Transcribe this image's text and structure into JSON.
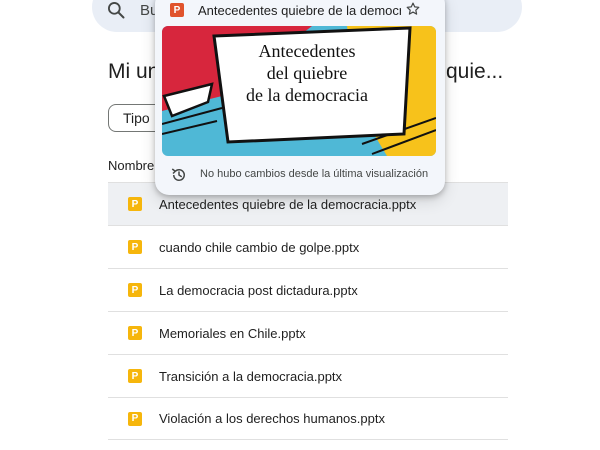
{
  "search": {
    "placeholder_visible": "Bu"
  },
  "page": {
    "title_start": "Mi un",
    "title_end": "quie..."
  },
  "filters": {
    "tipo_label": "Tipo"
  },
  "table": {
    "column_name": "Nombre"
  },
  "files": [
    {
      "name": "Antecedentes quiebre de la democracia.pptx",
      "icon": "P"
    },
    {
      "name": "cuando chile cambio de golpe.pptx",
      "icon": "P"
    },
    {
      "name": "La democracia post dictadura.pptx",
      "icon": "P"
    },
    {
      "name": "Memoriales en Chile.pptx",
      "icon": "P"
    },
    {
      "name": "Transición a la democracia.pptx",
      "icon": "P"
    },
    {
      "name": "Violación a los derechos humanos.pptx",
      "icon": "P"
    }
  ],
  "preview": {
    "title": "Antecedentes quiebre de la democracia.pptx",
    "icon": "P",
    "slide_line1": "Antecedentes",
    "slide_line2": "del quiebre",
    "slide_line3": "de la democracia",
    "footer": "No hubo cambios desde la última visualización"
  },
  "colors": {
    "pptx_icon": "#f6b60c",
    "ppt_header_icon": "#e0532c",
    "slide_red": "#d7263d",
    "slide_yellow": "#f7c21b",
    "slide_blue": "#4fb8d6"
  }
}
